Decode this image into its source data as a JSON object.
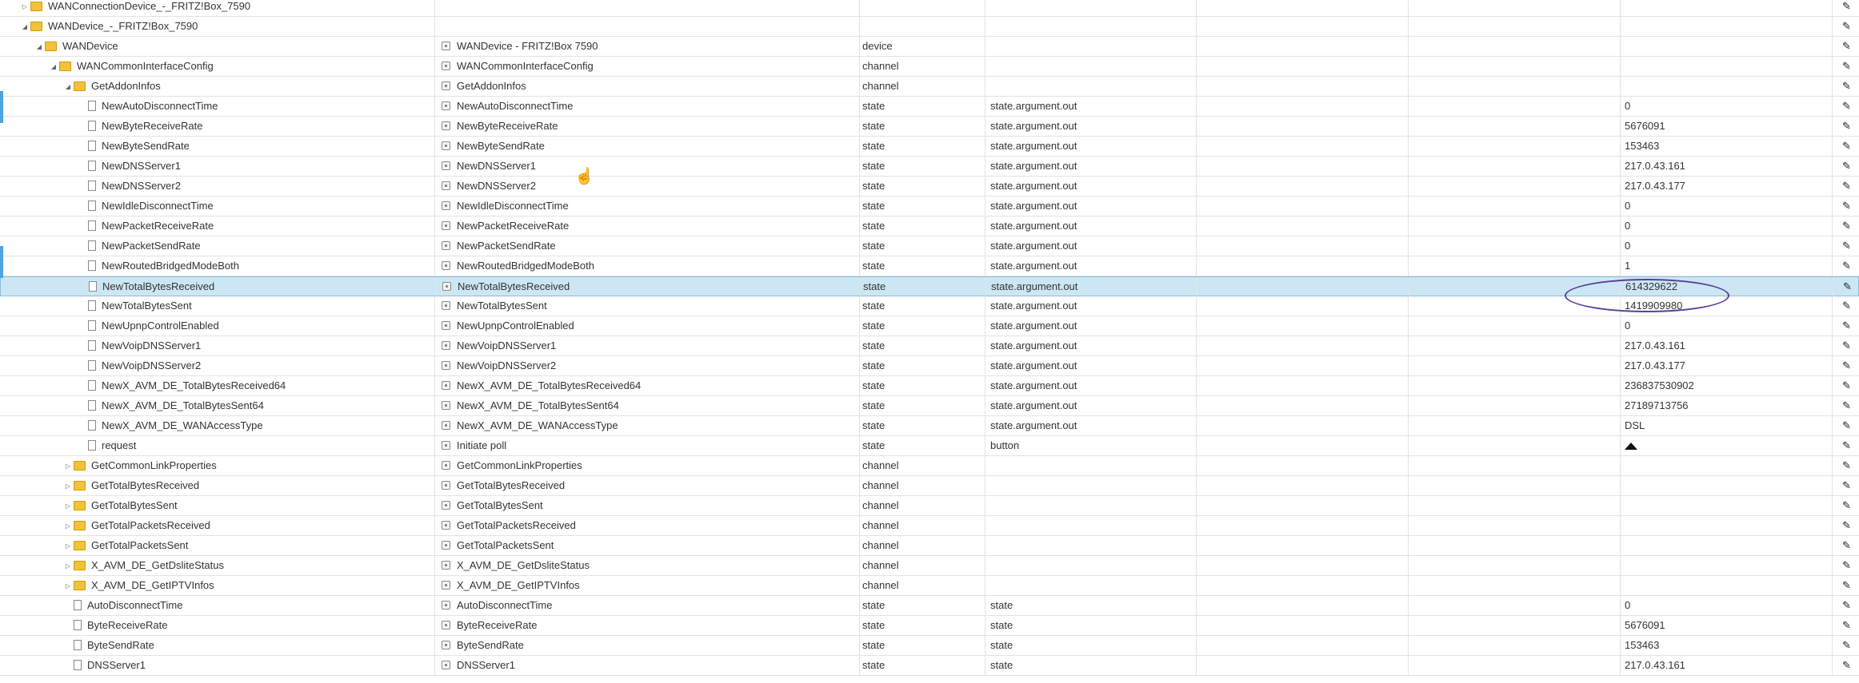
{
  "rows": [
    {
      "level": 0,
      "kind": "folder",
      "toggle": "▷",
      "name": "WANConnectionDevice_-_FRITZ!Box_7590",
      "title": "",
      "type": "",
      "role": "",
      "value": ""
    },
    {
      "level": 0,
      "kind": "folder",
      "toggle": "◢",
      "name": "WANDevice_-_FRITZ!Box_7590",
      "title": "",
      "type": "",
      "role": "",
      "value": ""
    },
    {
      "level": 1,
      "kind": "folder",
      "toggle": "◢",
      "name": "WANDevice",
      "title": "WANDevice - FRITZ!Box 7590",
      "type": "device",
      "role": "",
      "value": ""
    },
    {
      "level": 2,
      "kind": "folder",
      "toggle": "◢",
      "name": "WANCommonInterfaceConfig",
      "title": "WANCommonInterfaceConfig",
      "type": "channel",
      "role": "",
      "value": ""
    },
    {
      "level": 3,
      "kind": "folder",
      "toggle": "◢",
      "name": "GetAddonInfos",
      "title": "GetAddonInfos",
      "type": "channel",
      "role": "",
      "value": ""
    },
    {
      "level": 4,
      "kind": "file",
      "toggle": "",
      "name": "NewAutoDisconnectTime",
      "title": "NewAutoDisconnectTime",
      "type": "state",
      "role": "state.argument.out",
      "value": "0"
    },
    {
      "level": 4,
      "kind": "file",
      "toggle": "",
      "name": "NewByteReceiveRate",
      "title": "NewByteReceiveRate",
      "type": "state",
      "role": "state.argument.out",
      "value": "5676091"
    },
    {
      "level": 4,
      "kind": "file",
      "toggle": "",
      "name": "NewByteSendRate",
      "title": "NewByteSendRate",
      "type": "state",
      "role": "state.argument.out",
      "value": "153463"
    },
    {
      "level": 4,
      "kind": "file",
      "toggle": "",
      "name": "NewDNSServer1",
      "title": "NewDNSServer1",
      "type": "state",
      "role": "state.argument.out",
      "value": "217.0.43.161"
    },
    {
      "level": 4,
      "kind": "file",
      "toggle": "",
      "name": "NewDNSServer2",
      "title": "NewDNSServer2",
      "type": "state",
      "role": "state.argument.out",
      "value": "217.0.43.177"
    },
    {
      "level": 4,
      "kind": "file",
      "toggle": "",
      "name": "NewIdleDisconnectTime",
      "title": "NewIdleDisconnectTime",
      "type": "state",
      "role": "state.argument.out",
      "value": "0"
    },
    {
      "level": 4,
      "kind": "file",
      "toggle": "",
      "name": "NewPacketReceiveRate",
      "title": "NewPacketReceiveRate",
      "type": "state",
      "role": "state.argument.out",
      "value": "0"
    },
    {
      "level": 4,
      "kind": "file",
      "toggle": "",
      "name": "NewPacketSendRate",
      "title": "NewPacketSendRate",
      "type": "state",
      "role": "state.argument.out",
      "value": "0"
    },
    {
      "level": 4,
      "kind": "file",
      "toggle": "",
      "name": "NewRoutedBridgedModeBoth",
      "title": "NewRoutedBridgedModeBoth",
      "type": "state",
      "role": "state.argument.out",
      "value": "1"
    },
    {
      "level": 4,
      "kind": "file",
      "toggle": "",
      "name": "NewTotalBytesReceived",
      "title": "NewTotalBytesReceived",
      "type": "state",
      "role": "state.argument.out",
      "value": "614329622",
      "selected": true
    },
    {
      "level": 4,
      "kind": "file",
      "toggle": "",
      "name": "NewTotalBytesSent",
      "title": "NewTotalBytesSent",
      "type": "state",
      "role": "state.argument.out",
      "value": "1419909980"
    },
    {
      "level": 4,
      "kind": "file",
      "toggle": "",
      "name": "NewUpnpControlEnabled",
      "title": "NewUpnpControlEnabled",
      "type": "state",
      "role": "state.argument.out",
      "value": "0"
    },
    {
      "level": 4,
      "kind": "file",
      "toggle": "",
      "name": "NewVoipDNSServer1",
      "title": "NewVoipDNSServer1",
      "type": "state",
      "role": "state.argument.out",
      "value": "217.0.43.161"
    },
    {
      "level": 4,
      "kind": "file",
      "toggle": "",
      "name": "NewVoipDNSServer2",
      "title": "NewVoipDNSServer2",
      "type": "state",
      "role": "state.argument.out",
      "value": "217.0.43.177"
    },
    {
      "level": 4,
      "kind": "file",
      "toggle": "",
      "name": "NewX_AVM_DE_TotalBytesReceived64",
      "title": "NewX_AVM_DE_TotalBytesReceived64",
      "type": "state",
      "role": "state.argument.out",
      "value": "236837530902"
    },
    {
      "level": 4,
      "kind": "file",
      "toggle": "",
      "name": "NewX_AVM_DE_TotalBytesSent64",
      "title": "NewX_AVM_DE_TotalBytesSent64",
      "type": "state",
      "role": "state.argument.out",
      "value": "27189713756"
    },
    {
      "level": 4,
      "kind": "file",
      "toggle": "",
      "name": "NewX_AVM_DE_WANAccessType",
      "title": "NewX_AVM_DE_WANAccessType",
      "type": "state",
      "role": "state.argument.out",
      "value": "DSL"
    },
    {
      "level": 4,
      "kind": "file",
      "toggle": "",
      "name": "request",
      "title": "Initiate poll",
      "type": "state",
      "role": "button",
      "value": "",
      "button": true
    },
    {
      "level": 3,
      "kind": "folder",
      "toggle": "▷",
      "name": "GetCommonLinkProperties",
      "title": "GetCommonLinkProperties",
      "type": "channel",
      "role": "",
      "value": ""
    },
    {
      "level": 3,
      "kind": "folder",
      "toggle": "▷",
      "name": "GetTotalBytesReceived",
      "title": "GetTotalBytesReceived",
      "type": "channel",
      "role": "",
      "value": ""
    },
    {
      "level": 3,
      "kind": "folder",
      "toggle": "▷",
      "name": "GetTotalBytesSent",
      "title": "GetTotalBytesSent",
      "type": "channel",
      "role": "",
      "value": ""
    },
    {
      "level": 3,
      "kind": "folder",
      "toggle": "▷",
      "name": "GetTotalPacketsReceived",
      "title": "GetTotalPacketsReceived",
      "type": "channel",
      "role": "",
      "value": ""
    },
    {
      "level": 3,
      "kind": "folder",
      "toggle": "▷",
      "name": "GetTotalPacketsSent",
      "title": "GetTotalPacketsSent",
      "type": "channel",
      "role": "",
      "value": ""
    },
    {
      "level": 3,
      "kind": "folder",
      "toggle": "▷",
      "name": "X_AVM_DE_GetDsliteStatus",
      "title": "X_AVM_DE_GetDsliteStatus",
      "type": "channel",
      "role": "",
      "value": ""
    },
    {
      "level": 3,
      "kind": "folder",
      "toggle": "▷",
      "name": "X_AVM_DE_GetIPTVInfos",
      "title": "X_AVM_DE_GetIPTVInfos",
      "type": "channel",
      "role": "",
      "value": ""
    },
    {
      "level": 3,
      "kind": "file",
      "toggle": "",
      "name": "AutoDisconnectTime",
      "title": "AutoDisconnectTime",
      "type": "state",
      "role": "state",
      "value": "0"
    },
    {
      "level": 3,
      "kind": "file",
      "toggle": "",
      "name": "ByteReceiveRate",
      "title": "ByteReceiveRate",
      "type": "state",
      "role": "state",
      "value": "5676091"
    },
    {
      "level": 3,
      "kind": "file",
      "toggle": "",
      "name": "ByteSendRate",
      "title": "ByteSendRate",
      "type": "state",
      "role": "state",
      "value": "153463"
    },
    {
      "level": 3,
      "kind": "file",
      "toggle": "",
      "name": "DNSServer1",
      "title": "DNSServer1",
      "type": "state",
      "role": "state",
      "value": "217.0.43.161"
    }
  ],
  "icons": {
    "edit": "pencil-icon",
    "folder": "folder-icon",
    "file": "file-icon",
    "type": "type-icon"
  }
}
